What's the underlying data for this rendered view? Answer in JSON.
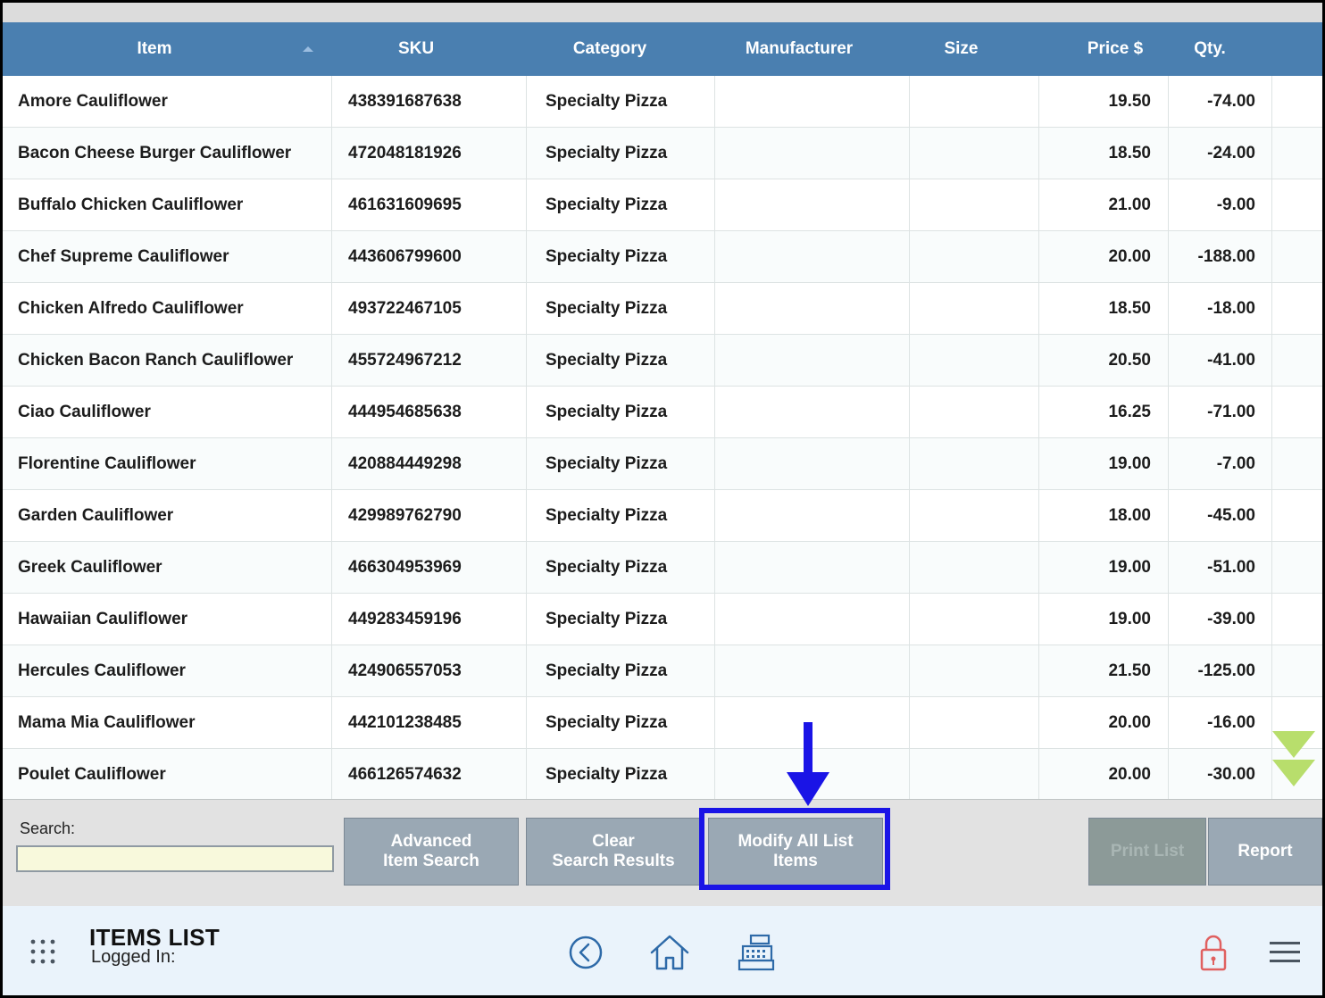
{
  "table": {
    "columns": [
      "Item",
      "SKU",
      "Category",
      "Manufacturer",
      "Size",
      "Price $",
      "Qty."
    ],
    "rows": [
      {
        "item": "Amore Cauliflower",
        "sku": "438391687638",
        "category": "Specialty Pizza",
        "manufacturer": "",
        "size": "",
        "price": "19.50",
        "qty": "-74.00"
      },
      {
        "item": "Bacon Cheese Burger Cauliflower",
        "sku": "472048181926",
        "category": "Specialty Pizza",
        "manufacturer": "",
        "size": "",
        "price": "18.50",
        "qty": "-24.00"
      },
      {
        "item": "Buffalo Chicken Cauliflower",
        "sku": "461631609695",
        "category": "Specialty Pizza",
        "manufacturer": "",
        "size": "",
        "price": "21.00",
        "qty": "-9.00"
      },
      {
        "item": "Chef Supreme Cauliflower",
        "sku": "443606799600",
        "category": "Specialty Pizza",
        "manufacturer": "",
        "size": "",
        "price": "20.00",
        "qty": "-188.00"
      },
      {
        "item": "Chicken Alfredo Cauliflower",
        "sku": "493722467105",
        "category": "Specialty Pizza",
        "manufacturer": "",
        "size": "",
        "price": "18.50",
        "qty": "-18.00"
      },
      {
        "item": "Chicken Bacon Ranch Cauliflower",
        "sku": "455724967212",
        "category": "Specialty Pizza",
        "manufacturer": "",
        "size": "",
        "price": "20.50",
        "qty": "-41.00"
      },
      {
        "item": "Ciao Cauliflower",
        "sku": "444954685638",
        "category": "Specialty Pizza",
        "manufacturer": "",
        "size": "",
        "price": "16.25",
        "qty": "-71.00"
      },
      {
        "item": "Florentine Cauliflower",
        "sku": "420884449298",
        "category": "Specialty Pizza",
        "manufacturer": "",
        "size": "",
        "price": "19.00",
        "qty": "-7.00"
      },
      {
        "item": "Garden Cauliflower",
        "sku": "429989762790",
        "category": "Specialty Pizza",
        "manufacturer": "",
        "size": "",
        "price": "18.00",
        "qty": "-45.00"
      },
      {
        "item": "Greek Cauliflower",
        "sku": "466304953969",
        "category": "Specialty Pizza",
        "manufacturer": "",
        "size": "",
        "price": "19.00",
        "qty": "-51.00"
      },
      {
        "item": "Hawaiian Cauliflower",
        "sku": "449283459196",
        "category": "Specialty Pizza",
        "manufacturer": "",
        "size": "",
        "price": "19.00",
        "qty": "-39.00"
      },
      {
        "item": "Hercules Cauliflower",
        "sku": "424906557053",
        "category": "Specialty Pizza",
        "manufacturer": "",
        "size": "",
        "price": "21.50",
        "qty": "-125.00"
      },
      {
        "item": "Mama Mia Cauliflower",
        "sku": "442101238485",
        "category": "Specialty Pizza",
        "manufacturer": "",
        "size": "",
        "price": "20.00",
        "qty": "-16.00"
      },
      {
        "item": "Poulet Cauliflower",
        "sku": "466126574632",
        "category": "Specialty Pizza",
        "manufacturer": "",
        "size": "",
        "price": "20.00",
        "qty": "-30.00"
      }
    ]
  },
  "toolbar": {
    "search_label": "Search:",
    "search_value": "",
    "advanced_search": "Advanced\nItem Search",
    "clear_search": "Clear\nSearch Results",
    "modify_all": "Modify All List\nItems",
    "print_list": "Print List",
    "report": "Report"
  },
  "footer": {
    "title": "ITEMS LIST",
    "logged_in": "Logged In:"
  },
  "icons": {
    "sort": "sort-ascending-icon",
    "scroll": "scroll-down-double-chevron-icon",
    "apps": "apps-grid-icon",
    "back": "back-arrow-circle-icon",
    "home": "home-icon",
    "register": "cash-register-icon",
    "lock": "lock-icon",
    "menu": "hamburger-menu-icon",
    "annotation": "arrow-down-icon"
  },
  "colors": {
    "header": "#4a7fb0",
    "button": "#9aa8b4",
    "highlight": "#1a14e6",
    "search_bg": "#f8f9dc",
    "footer_bg": "#eaf3fb",
    "scroll_green": "#b8de6c",
    "lock_red": "#e06060"
  }
}
